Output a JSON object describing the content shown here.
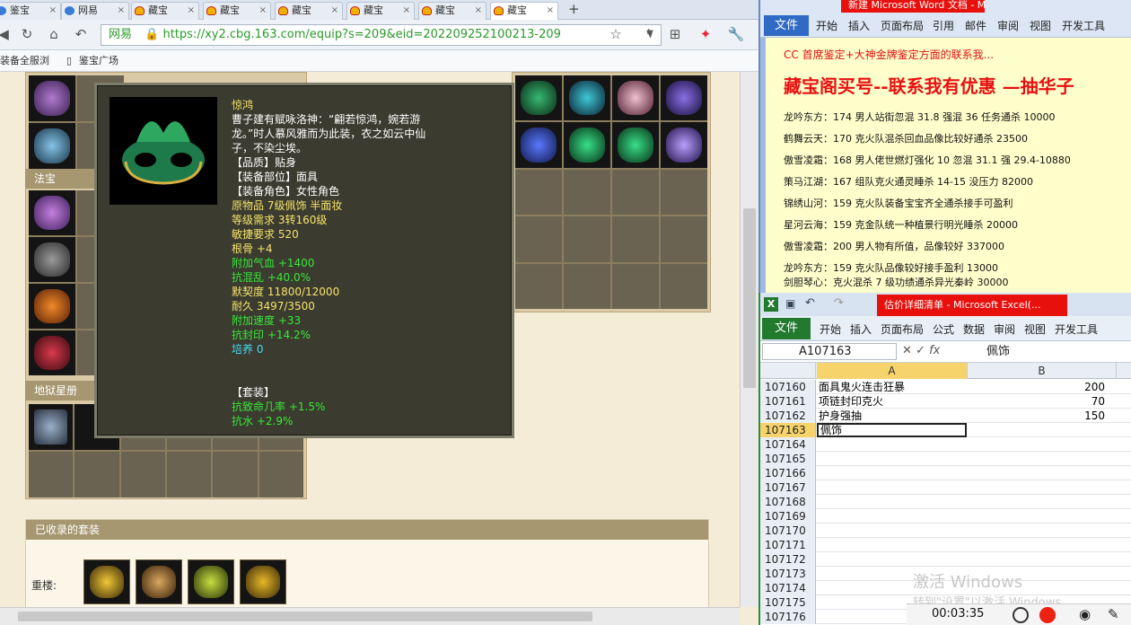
{
  "browser": {
    "tabs": [
      "鉴宝",
      "网易",
      "藏宝",
      "藏宝",
      "藏宝",
      "藏宝",
      "藏宝",
      "藏宝"
    ],
    "address": {
      "badge": "网易",
      "url": "https://xy2.cbg.163.com/equip?s=209&eid=202209252100213-209"
    },
    "bookmarks": [
      "装备全服浏",
      "鉴宝广场"
    ]
  },
  "game": {
    "sections": {
      "fabao": "法宝",
      "diliao": "地狱星册"
    },
    "suit_header": "已收录的套装",
    "suit_label": "重楼:",
    "tooltip": {
      "name": "惊鸿",
      "desc": "曹子建有赋咏洛神：“翩若惊鸿，婉若游龙。”时人慕风雅而为此装，衣之如云中仙子，不染尘埃。",
      "lines": [
        {
          "text": "【品质】贴身",
          "color": "w"
        },
        {
          "text": "【装备部位】面具",
          "color": "w"
        },
        {
          "text": "【装备角色】女性角色",
          "color": "w"
        },
        {
          "text": "原物品 7级佩饰 半面妆",
          "color": "y"
        },
        {
          "text": "等级需求 3转160级",
          "color": "y"
        },
        {
          "text": "敏捷要求 520",
          "color": "y"
        },
        {
          "text": "根骨 +4",
          "color": "y"
        },
        {
          "text": "附加气血 +1400",
          "color": "g"
        },
        {
          "text": "抗混乱 +40.0%",
          "color": "g"
        },
        {
          "text": "默契度 11800/12000",
          "color": "y"
        },
        {
          "text": "耐久 3497/3500",
          "color": "y"
        },
        {
          "text": "附加速度 +33",
          "color": "g"
        },
        {
          "text": "抗封印 +14.2%",
          "color": "g"
        },
        {
          "text": "培养 0",
          "color": "c"
        }
      ],
      "set_title": "【套装】",
      "set_lines": [
        "抗致命几率 +1.5%",
        "抗水 +2.9%"
      ]
    }
  },
  "word": {
    "title": "新建 Microsoft Word 文档 - Mi...",
    "ribbon": [
      "文件",
      "开始",
      "插入",
      "页面布局",
      "引用",
      "邮件",
      "审阅",
      "视图",
      "开发工具"
    ],
    "heading_small": "CC 首席鉴定+大神金牌鉴定方面的联系我...",
    "heading": "藏宝阁买号--联系我有优惠 —抽华子",
    "lines": [
      "龙吟东方：174 男人站街忽混 31.8 强混 36 任务通杀 10000",
      "鹤舞云天：170 克火队混杀回血品像比较好通杀 23500",
      "傲雪凌霜：168 男人佬世燃灯强化 10 忽混 31.1 强 29.4-10880",
      "策马江湖：167 组队克火通灵睡杀 14-15 没压力 82000",
      "锦绣山河：159 克火队装备宝宝齐全通杀接手可盈利",
      "星河云海：159 克金队统一种植景行明光睡杀 20000",
      "傲雪凌霜：200 男人物有所值，品像较好 337000",
      "龙吟东方：159 克火队品像较好接手盈利 13000",
      "剑胆琴心：克火混杀 7 级功绩通杀异光秦岭 30000"
    ]
  },
  "excel": {
    "title": "估价详细清单 - Microsoft Excel(...",
    "ribbon": [
      "文件",
      "开始",
      "插入",
      "页面布局",
      "公式",
      "数据",
      "审阅",
      "视图",
      "开发工具"
    ],
    "namebox": "A107163",
    "formula": "佩饰",
    "columns": [
      "A",
      "B"
    ],
    "rows": [
      {
        "n": "107160",
        "a": "面具鬼火连击狂暴",
        "b": "200"
      },
      {
        "n": "107161",
        "a": "项链封印克火",
        "b": "70"
      },
      {
        "n": "107162",
        "a": "护身强抽",
        "b": "150"
      },
      {
        "n": "107163",
        "a": "佩饰",
        "b": ""
      },
      {
        "n": "107164",
        "a": "",
        "b": ""
      },
      {
        "n": "107165",
        "a": "",
        "b": ""
      },
      {
        "n": "107166",
        "a": "",
        "b": ""
      },
      {
        "n": "107167",
        "a": "",
        "b": ""
      },
      {
        "n": "107168",
        "a": "",
        "b": ""
      },
      {
        "n": "107169",
        "a": "",
        "b": ""
      },
      {
        "n": "107170",
        "a": "",
        "b": ""
      },
      {
        "n": "107171",
        "a": "",
        "b": ""
      },
      {
        "n": "107172",
        "a": "",
        "b": ""
      },
      {
        "n": "107173",
        "a": "",
        "b": ""
      },
      {
        "n": "107174",
        "a": "",
        "b": ""
      },
      {
        "n": "107175",
        "a": "",
        "b": ""
      },
      {
        "n": "107176",
        "a": "",
        "b": ""
      }
    ],
    "watermark": "激活 Windows",
    "watermark_sub": "转到\"设置\"以激活 Windows。"
  },
  "recorder": {
    "time": "00:03:35"
  }
}
